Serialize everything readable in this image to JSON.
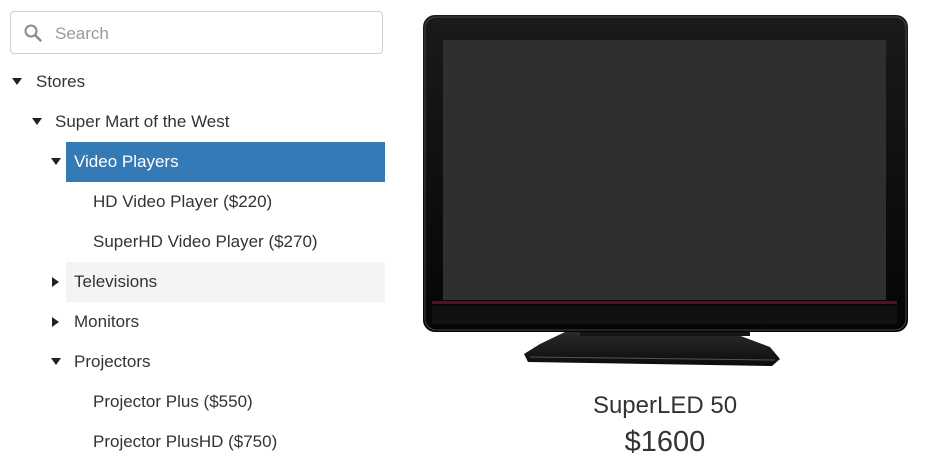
{
  "search": {
    "placeholder": "Search",
    "value": ""
  },
  "tree": {
    "root": {
      "label": "Stores",
      "expanded": true
    },
    "store": {
      "label": "Super Mart of the West",
      "expanded": true
    },
    "categories": [
      {
        "label": "Video Players",
        "expanded": true,
        "selected": true,
        "products": [
          "HD Video Player ($220)",
          "SuperHD Video Player ($270)"
        ]
      },
      {
        "label": "Televisions",
        "expanded": false,
        "hovered": true
      },
      {
        "label": "Monitors",
        "expanded": false
      },
      {
        "label": "Projectors",
        "expanded": true,
        "products": [
          "Projector Plus ($550)",
          "Projector PlusHD ($750)"
        ]
      }
    ]
  },
  "colors": {
    "selected": "#337ab7",
    "hover": "#f4f4f4"
  },
  "product": {
    "image_icon": "television-image",
    "name": "SuperLED 50",
    "price": "$1600"
  }
}
